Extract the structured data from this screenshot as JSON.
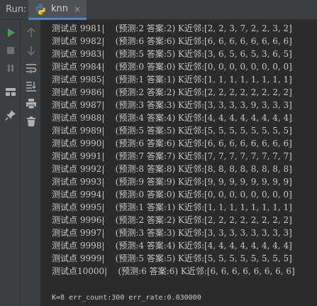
{
  "header": {
    "run_label": "Run:",
    "tab_title": "knn",
    "tab_close": "×"
  },
  "toolbar": {
    "left": [
      "run-icon",
      "stop-icon",
      "pause-icon",
      "layout-icon",
      "pin-icon"
    ],
    "right": [
      "up-arrow-icon",
      "down-arrow-icon",
      "soft-wrap-icon",
      "scroll-to-end-icon",
      "print-icon",
      "trash-icon"
    ]
  },
  "console": {
    "lines": [
      "测试点 9981|    (预测:2 答案:2) K近邻:[2, 2, 3, 7, 2, 2, 3, 2]",
      "测试点 9982|    (预测:6 答案:6) K近邻:[6, 6, 6, 6, 6, 6, 6, 6]",
      "测试点 9983|    (预测:5 答案:5) K近邻:[3, 6, 5, 6, 5, 3, 6, 5]",
      "测试点 9984|    (预测:0 答案:0) K近邻:[0, 0, 0, 0, 0, 0, 0, 0]",
      "测试点 9985|    (预测:1 答案:1) K近邻:[1, 1, 1, 1, 1, 1, 1, 1]",
      "测试点 9986|    (预测:2 答案:2) K近邻:[2, 2, 2, 2, 2, 2, 2, 2]",
      "测试点 9987|    (预测:3 答案:3) K近邻:[3, 3, 3, 3, 9, 3, 3, 3]",
      "测试点 9988|    (预测:4 答案:4) K近邻:[4, 4, 4, 4, 4, 4, 4, 4]",
      "测试点 9989|    (预测:5 答案:5) K近邻:[5, 5, 5, 5, 5, 5, 5, 5]",
      "测试点 9990|    (预测:6 答案:6) K近邻:[6, 6, 6, 6, 6, 6, 6, 6]",
      "测试点 9991|    (预测:7 答案:7) K近邻:[7, 7, 7, 7, 7, 7, 7, 7]",
      "测试点 9992|    (预测:8 答案:8) K近邻:[8, 8, 8, 8, 8, 8, 8, 8]",
      "测试点 9993|    (预测:9 答案:9) K近邻:[9, 9, 9, 9, 9, 9, 9, 9]",
      "测试点 9994|    (预测:0 答案:0) K近邻:[0, 0, 0, 0, 0, 0, 0, 0]",
      "测试点 9995|    (预测:1 答案:1) K近邻:[1, 1, 1, 1, 1, 1, 1, 1]",
      "测试点 9996|    (预测:2 答案:2) K近邻:[2, 2, 2, 2, 2, 2, 2, 2]",
      "测试点 9997|    (预测:3 答案:3) K近邻:[3, 3, 3, 3, 3, 3, 3, 3]",
      "测试点 9998|    (预测:4 答案:4) K近邻:[4, 4, 4, 4, 4, 4, 4, 4]",
      "测试点 9999|    (预测:5 答案:5) K近邻:[5, 5, 5, 5, 5, 5, 5, 5]",
      "测试点10000|    (预测:6 答案:6) K近邻:[6, 6, 6, 6, 6, 6, 6, 6]"
    ],
    "summary": "K=8 err_count:300 err_rate:0.030000"
  },
  "colors": {
    "run_green": "#499c54",
    "python_blue": "#3c78aa",
    "python_yellow": "#f2c53d",
    "icon_gray": "#afb1b3",
    "icon_dim": "#6e6e6e"
  }
}
